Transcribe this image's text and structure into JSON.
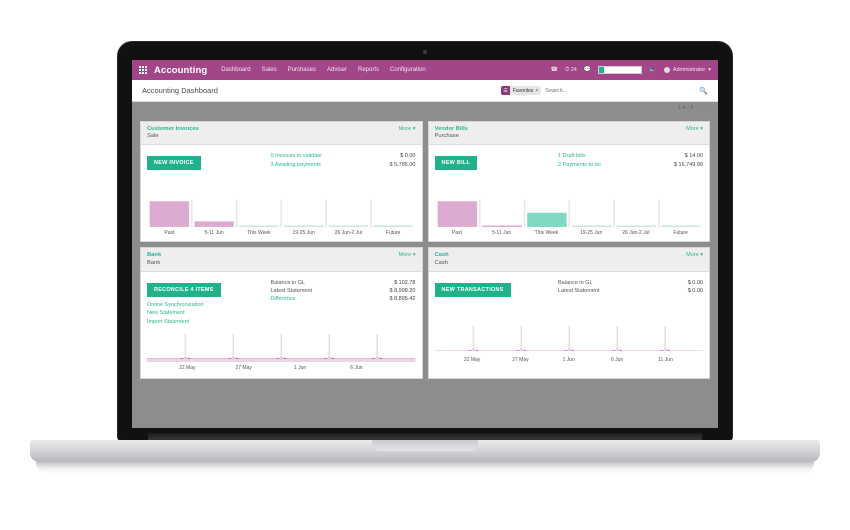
{
  "navbar": {
    "apps_icon": "apps-grid-icon",
    "brand": "Accounting",
    "menu": [
      "Dashboard",
      "Sales",
      "Purchases",
      "Adviser",
      "Reports",
      "Configuration"
    ],
    "phone_icon": "phone-icon",
    "clock_icon": "clock-icon",
    "activity_count": "24",
    "chat_icon": "chat-bubble-icon",
    "volume_icon": "volume-icon",
    "user_name": "Administrator",
    "user_caret": "chevron-down-icon",
    "accent_color": "#a24689",
    "progress_color": "#26b28d"
  },
  "control_panel": {
    "title": "Accounting Dashboard",
    "facet_icon": "filter-icon",
    "facet_label": "Favorites",
    "facet_remove": "×",
    "search_placeholder": "Search...",
    "search_value": "",
    "search_icon": "search-icon",
    "pager_count": "1-4 / 4",
    "pager_prev": "‹",
    "pager_next": "›"
  },
  "cards": [
    {
      "title": "Customer Invoices",
      "subtitle": "Sale",
      "more": "More",
      "button": "NEW INVOICE",
      "links": [],
      "stats": [
        {
          "label": "0 Invoices to validate",
          "value": "$ 0.00",
          "link": true
        },
        {
          "label": "3 Awaiting payments",
          "value": "$ 5,785.00",
          "link": true
        }
      ]
    },
    {
      "title": "Vendor Bills",
      "subtitle": "Purchase",
      "more": "More",
      "button": "NEW BILL",
      "links": [],
      "stats": [
        {
          "label": "1 Draft bills",
          "value": "$ 14.00",
          "link": true
        },
        {
          "label": "2 Payments to do",
          "value": "$ 15,749.99",
          "link": true
        }
      ]
    },
    {
      "title": "Bank",
      "subtitle": "Bank",
      "more": "More",
      "button": "RECONCILE 4 ITEMS",
      "links": [
        "Online Synchronization",
        "New Statement",
        "Import Statement"
      ],
      "stats": [
        {
          "label": "Balance in GL",
          "value": "$ 102.78",
          "link": false
        },
        {
          "label": "Latest Statement",
          "value": "$ 8,998.20",
          "link": false
        },
        {
          "label": "Difference",
          "value": "$ 8,895.42",
          "link": true
        }
      ]
    },
    {
      "title": "Cash",
      "subtitle": "Cash",
      "more": "More",
      "button": "NEW TRANSACTIONS",
      "links": [],
      "stats": [
        {
          "label": "Balance in GL",
          "value": "$ 0.00",
          "link": false
        },
        {
          "label": "Latest Statement",
          "value": "$ 0.00",
          "link": false
        }
      ]
    }
  ],
  "chart_data": [
    {
      "type": "bar",
      "card": "Customer Invoices",
      "categories": [
        "Past",
        "5-11 Jun",
        "This Week",
        "19-25 Jun",
        "26 Jun-2 Jul",
        "Future"
      ],
      "values": [
        1.0,
        0.22,
        0.0,
        0.0,
        0.0,
        0.0
      ],
      "colors": [
        "#ddabd0",
        "#ddabd0",
        "#c6ebe2",
        "#c6ebe2",
        "#c6ebe2",
        "#c6ebe2"
      ],
      "title": "",
      "xlabel": "",
      "ylabel": "",
      "ylim": [
        0,
        1
      ],
      "grid": true,
      "legend": "none"
    },
    {
      "type": "bar",
      "card": "Vendor Bills",
      "categories": [
        "Past",
        "5-11 Jun",
        "This Week",
        "19-25 Jun",
        "26 Jun-2 Jul",
        "Future"
      ],
      "values": [
        1.0,
        0.0,
        0.55,
        0.0,
        0.0,
        0.0
      ],
      "colors": [
        "#ddabd0",
        "#ddabd0",
        "#7fd9c4",
        "#c6ebe2",
        "#c6ebe2",
        "#c6ebe2"
      ],
      "title": "",
      "xlabel": "",
      "ylabel": "",
      "ylim": [
        0,
        1
      ],
      "grid": true,
      "legend": "none"
    },
    {
      "type": "area",
      "card": "Bank",
      "x": [
        "22 May",
        "27 May",
        "1 Jun",
        "6 Jun",
        ""
      ],
      "values": [
        0,
        0,
        0,
        0,
        0
      ],
      "fill_color": "#ecd4e6",
      "line_color": "#b5539b",
      "title": "",
      "xlabel": "",
      "ylabel": "",
      "ylim": [
        0,
        1
      ],
      "grid": true,
      "legend": "none"
    },
    {
      "type": "line",
      "card": "Cash",
      "x": [
        "22 May",
        "27 May",
        "1 Jun",
        "6 Jun",
        "11 Jun"
      ],
      "values": [
        0,
        0,
        0,
        0,
        0
      ],
      "line_color": "#c06bae",
      "title": "",
      "xlabel": "",
      "ylabel": "",
      "ylim": [
        0,
        1
      ],
      "grid": true,
      "legend": "none"
    }
  ]
}
